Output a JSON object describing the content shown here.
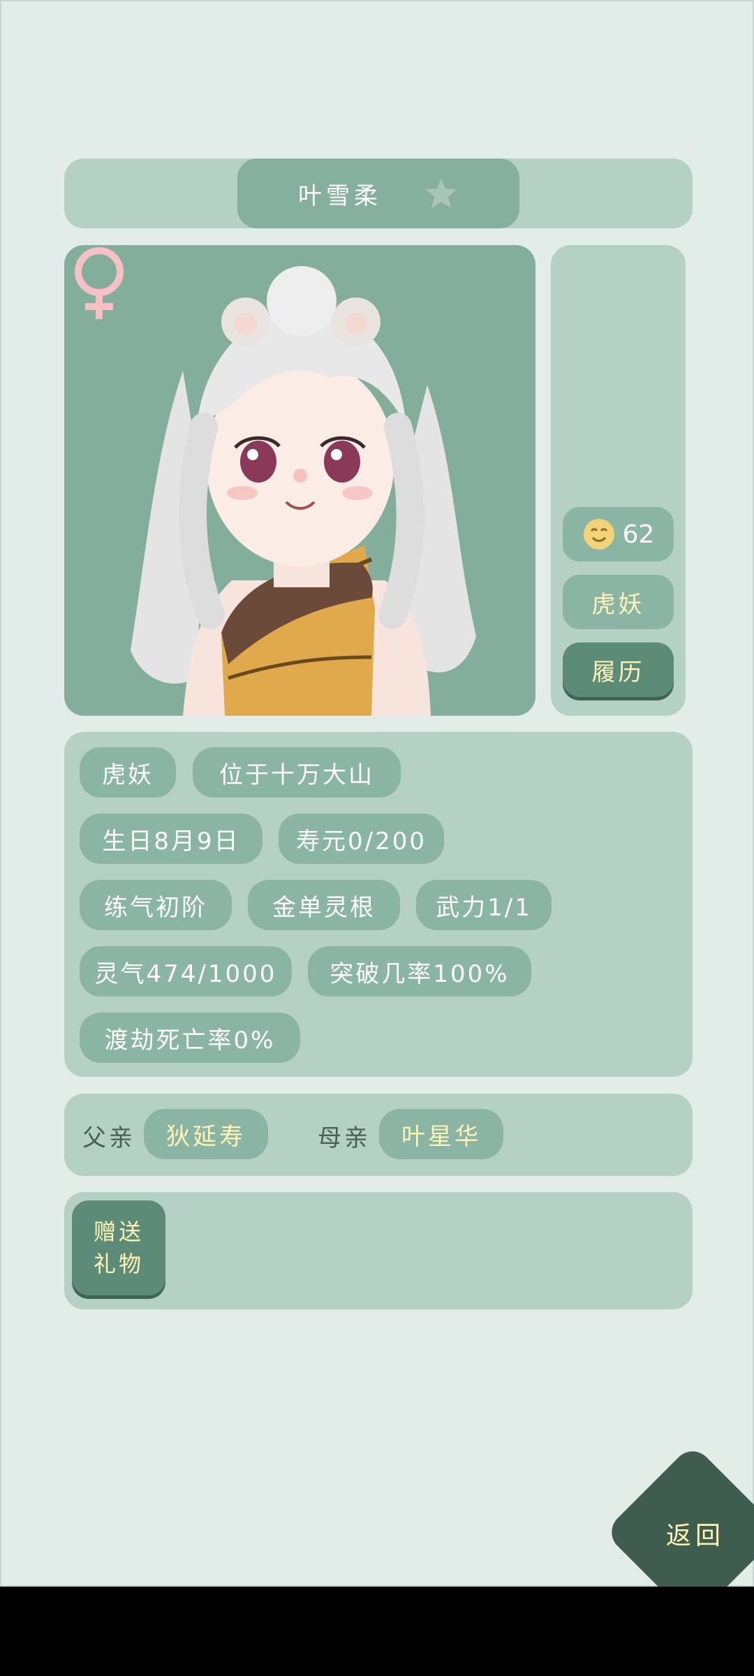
{
  "character": {
    "name": "叶雪柔",
    "favorite_icon": "star-icon"
  },
  "portrait": {
    "gender_icon": "female-symbol-icon"
  },
  "side": {
    "mood_value": "62",
    "mood_icon": "smiling-face-icon",
    "race": "虎妖",
    "history_button": "履历"
  },
  "attributes": {
    "race": "虎妖",
    "location": "位于十万大山",
    "birthday": "生日8月9日",
    "lifespan": "寿元0/200",
    "cultivation": "练气初阶",
    "spirit_root": "金单灵根",
    "force": "武力1/1",
    "spirit_qi": "灵气474/1000",
    "breakthrough": "突破几率100%",
    "tribulation": "渡劫死亡率0%"
  },
  "parents": {
    "father_label": "父亲",
    "father_name": "狄延寿",
    "mother_label": "母亲",
    "mother_name": "叶星华"
  },
  "gift": {
    "line1": "赠送",
    "line2": "礼物"
  },
  "nav": {
    "back": "返回"
  },
  "colors": {
    "background": "#e2edea",
    "panel": "#b5d1c5",
    "pill": "#8ab4a3",
    "button_dark": "#5c8b77",
    "accent_text": "#fff4b5",
    "back_button": "#3f5d4e"
  }
}
